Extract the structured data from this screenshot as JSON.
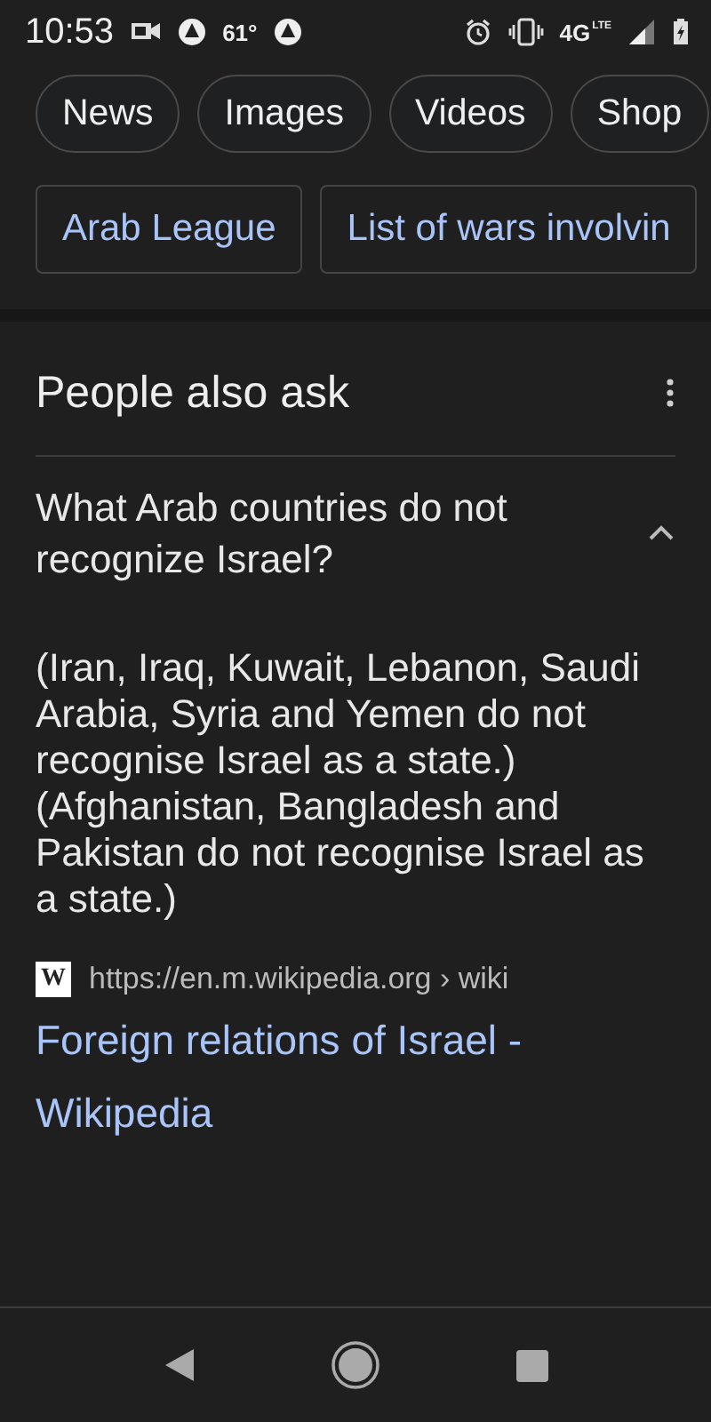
{
  "status_bar": {
    "time": "10:53",
    "temperature": "61°",
    "network": "4G",
    "network_sub": "LTE"
  },
  "filter_chips": [
    "News",
    "Images",
    "Videos",
    "Shop"
  ],
  "related_searches": [
    "Arab League",
    "List of wars involvin"
  ],
  "people_also_ask": {
    "title": "People also ask",
    "questions": [
      {
        "question": "What Arab countries do not recognize Israel?",
        "expanded": true,
        "answer": "(Iran, Iraq, Kuwait, Lebanon, Saudi Arabia, Syria and Yemen do not recognise Israel as a state.) (Afghanistan, Bangladesh and Pakistan do not recognise Israel as a state.)",
        "source": {
          "favicon": "W",
          "url": "https://en.m.wikipedia.org › wiki",
          "title": "Foreign relations of Israel - Wikipedia"
        }
      }
    ]
  }
}
